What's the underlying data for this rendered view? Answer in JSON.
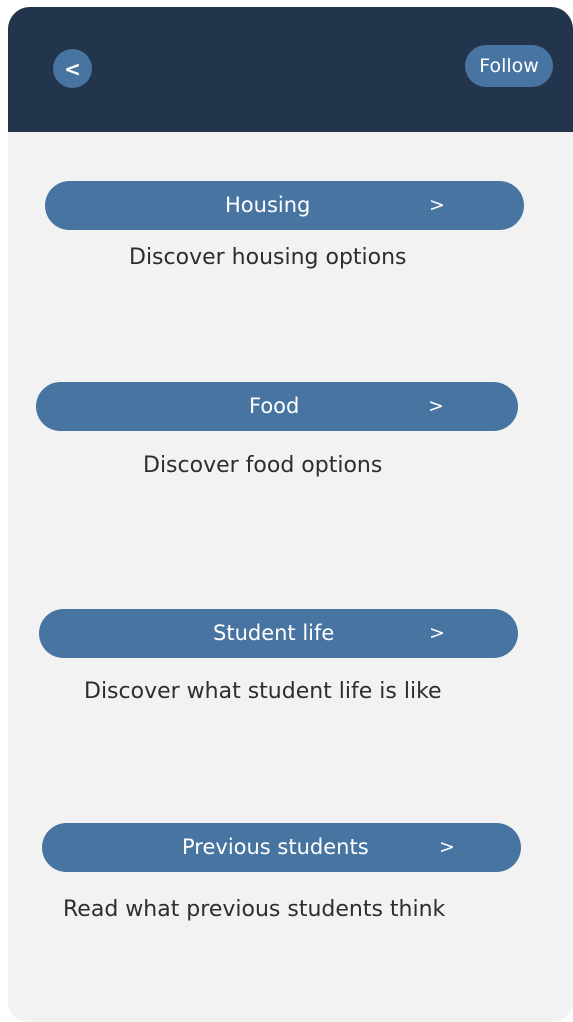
{
  "header": {
    "back_label": "<",
    "follow_label": "Follow"
  },
  "sections": [
    {
      "title": "Housing",
      "chevron": ">",
      "description": "Discover housing options"
    },
    {
      "title": "Food",
      "chevron": ">",
      "description": "Discover food options"
    },
    {
      "title": "Student life",
      "chevron": ">",
      "description": "Discover what student life is like"
    },
    {
      "title": "Previous students",
      "chevron": ">",
      "description": "Read what previous students think"
    }
  ],
  "colors": {
    "header_bg": "#22354d",
    "accent": "#4874a1",
    "page_bg": "#f2f2f2"
  }
}
